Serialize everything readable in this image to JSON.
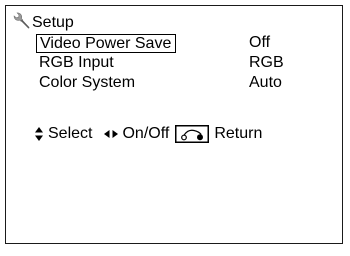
{
  "menu": {
    "title": "Setup",
    "title_icon": "wrench-icon",
    "items": [
      {
        "label": "Video Power Save",
        "value": "Off",
        "selected": true
      },
      {
        "label": "RGB Input",
        "value": "RGB",
        "selected": false
      },
      {
        "label": "Color System",
        "value": "Auto",
        "selected": false
      }
    ]
  },
  "legend": {
    "select_icon": "up-down-arrow-icon",
    "select_label": "Select",
    "onoff_icon": "left-right-arrow-icon",
    "onoff_label": "On/Off",
    "return_icon": "return-button-icon",
    "return_label": "Return"
  },
  "colors": {
    "background": "#ffffff",
    "text": "#000000",
    "icon_gray": "#8a8a8a"
  }
}
